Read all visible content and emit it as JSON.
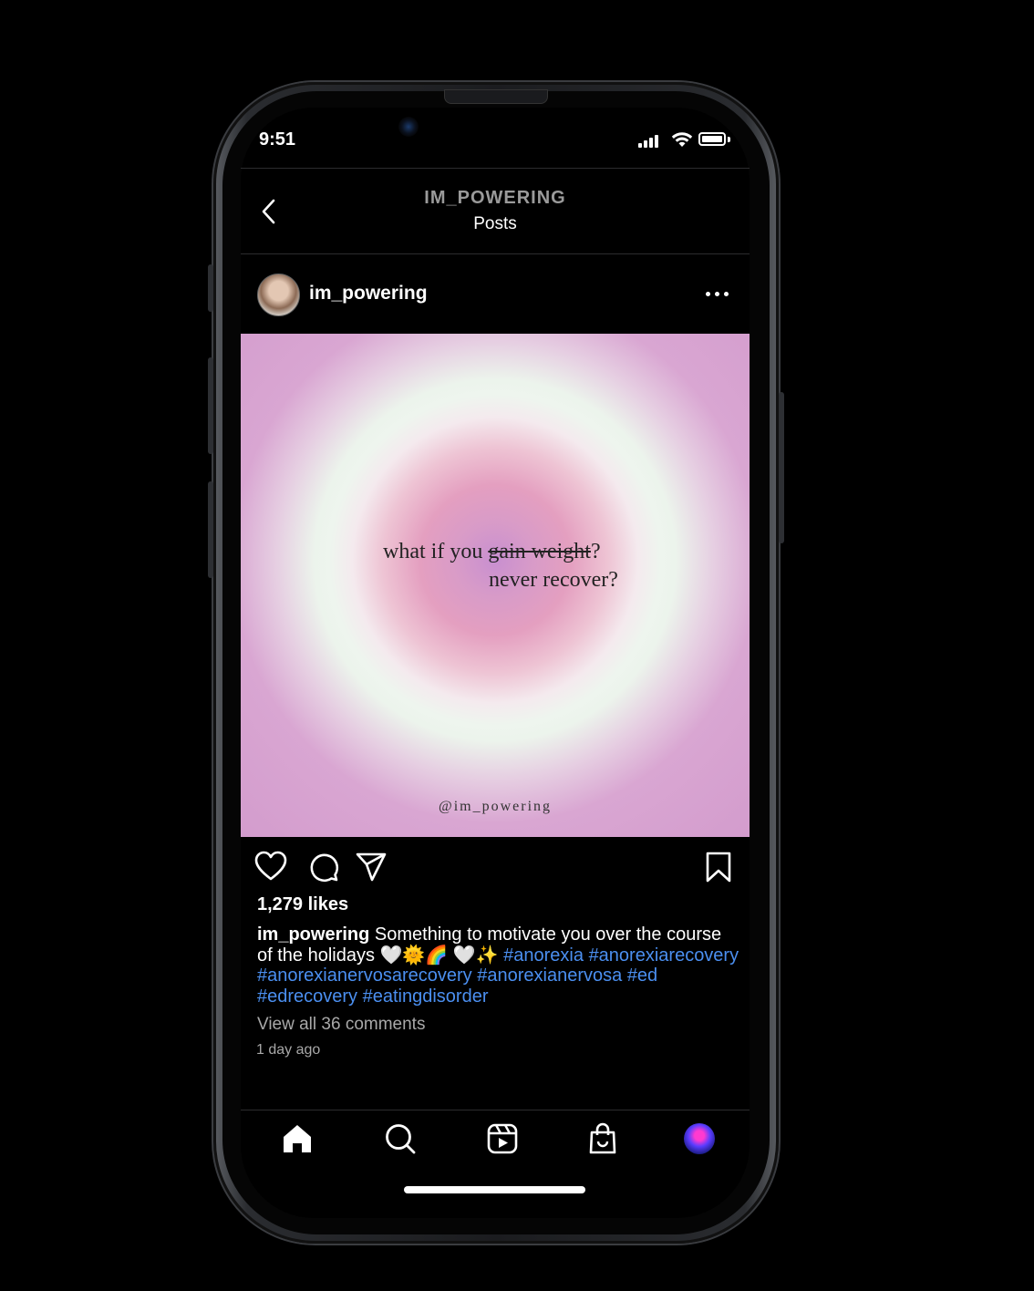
{
  "status_bar": {
    "time": "9:51"
  },
  "header": {
    "title": "IM_POWERING",
    "subtitle": "Posts"
  },
  "post": {
    "username": "im_powering",
    "image_text": {
      "line1_prefix": "what if you ",
      "line1_struck": "gain weight",
      "line1_suffix": "?",
      "line2": "never recover?",
      "watermark": "@im_powering"
    },
    "likes": "1,279 likes",
    "caption_user": "im_powering",
    "caption_text": " Something to motivate you over the course of the holidays 🤍🌞🌈 🤍✨ ",
    "hashtags": [
      "#anorexia",
      "#anorexiarecovery",
      "#anorexianervosarecovery",
      "#anorexianervosa",
      "#ed",
      "#edrecovery",
      "#eatingdisorder"
    ],
    "view_comments": "View all 36 comments",
    "time_ago": "1 day ago"
  },
  "icons": {
    "back": "chevron-left-icon",
    "more": "more-horizontal-icon",
    "like": "heart-icon",
    "comment": "comment-icon",
    "share": "send-icon",
    "save": "bookmark-icon",
    "tabs": [
      "home-icon",
      "search-icon",
      "reels-icon",
      "shop-icon",
      "profile-avatar"
    ]
  },
  "colors": {
    "background": "#000000",
    "hashtag": "#4b8ff0",
    "secondary_text": "#a8a8a8"
  }
}
